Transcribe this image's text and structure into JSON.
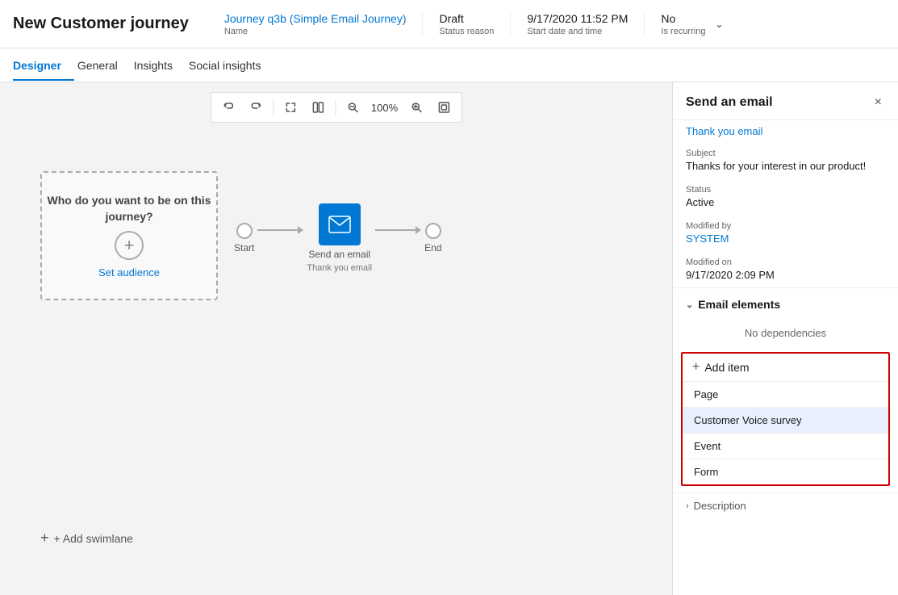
{
  "header": {
    "title": "New Customer journey",
    "journey_name": "Journey q3b (Simple Email Journey)",
    "journey_name_label": "Name",
    "status_reason": "Draft",
    "status_reason_label": "Status reason",
    "start_date": "9/17/2020 11:52 PM",
    "start_date_label": "Start date and time",
    "is_recurring": "No",
    "is_recurring_label": "Is recurring"
  },
  "tabs": [
    {
      "id": "designer",
      "label": "Designer",
      "active": true
    },
    {
      "id": "general",
      "label": "General",
      "active": false
    },
    {
      "id": "insights",
      "label": "Insights",
      "active": false
    },
    {
      "id": "social-insights",
      "label": "Social insights",
      "active": false
    }
  ],
  "canvas": {
    "audience": {
      "question": "Who do you want to be on this journey?",
      "link": "Set audience"
    },
    "nodes": [
      {
        "id": "start",
        "label": "Start"
      },
      {
        "id": "email",
        "label": "Send an email",
        "sublabel": "Thank you email"
      },
      {
        "id": "end",
        "label": "End"
      }
    ],
    "add_swimlane": "+ Add swimlane"
  },
  "toolbar": {
    "undo": "↺",
    "redo": "↻",
    "expand": "⤢",
    "columns": "⊞",
    "zoom_out": "−",
    "zoom_level": "100%",
    "zoom_in": "+",
    "fit": "⊡"
  },
  "panel": {
    "title": "Send an email",
    "close": "×",
    "link": "Thank you email",
    "subject_label": "Subject",
    "subject_value": "Thanks for your interest in our product!",
    "status_label": "Status",
    "status_value": "Active",
    "modified_by_label": "Modified by",
    "modified_by_value": "SYSTEM",
    "modified_on_label": "Modified on",
    "modified_on_value": "9/17/2020 2:09 PM",
    "email_elements_label": "Email elements",
    "no_dependencies": "No dependencies",
    "add_item_label": "Add item",
    "dropdown_items": [
      {
        "id": "page",
        "label": "Page"
      },
      {
        "id": "customer-voice",
        "label": "Customer Voice survey",
        "selected": true
      },
      {
        "id": "event",
        "label": "Event"
      },
      {
        "id": "form",
        "label": "Form"
      }
    ],
    "description_label": "Description"
  }
}
